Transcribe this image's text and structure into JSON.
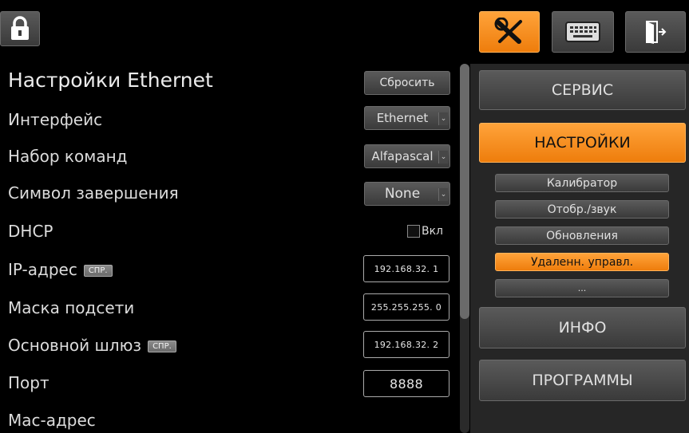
{
  "header": {
    "lock_icon": "lock-icon",
    "tools_icon": "tools-icon",
    "keyboard_icon": "keyboard-icon",
    "exit_icon": "exit-icon"
  },
  "settings": {
    "title": "Настройки Ethernet",
    "reset_label": "Сбросить",
    "rows": [
      {
        "label": "Интерфейс",
        "value": "Ethernet"
      },
      {
        "label": "Набор команд",
        "value": "Alfapascal"
      },
      {
        "label": "Символ завершения",
        "value": "None"
      },
      {
        "label": "DHCP",
        "checkbox_label": "Вкл"
      },
      {
        "label": "IP-адрес",
        "badge": "СПР.",
        "value": "192.168.32. 1"
      },
      {
        "label": "Маска подсети",
        "value": "255.255.255. 0"
      },
      {
        "label": "Основной шлюз",
        "badge": "СПР.",
        "value": "192.168.32. 2"
      },
      {
        "label": "Порт",
        "value": "8888"
      },
      {
        "label": "Mac-адрес"
      }
    ]
  },
  "menu": {
    "service": "СЕРВИС",
    "settings": "НАСТРОЙКИ",
    "sub_items": [
      "Калибратор",
      "Отобр./звук",
      "Обновления",
      "Удаленн. управл.",
      "..."
    ],
    "info": "ИНФО",
    "programs": "ПРОГРАММЫ"
  },
  "colors": {
    "accent": "#f4911f",
    "background": "#000000"
  }
}
